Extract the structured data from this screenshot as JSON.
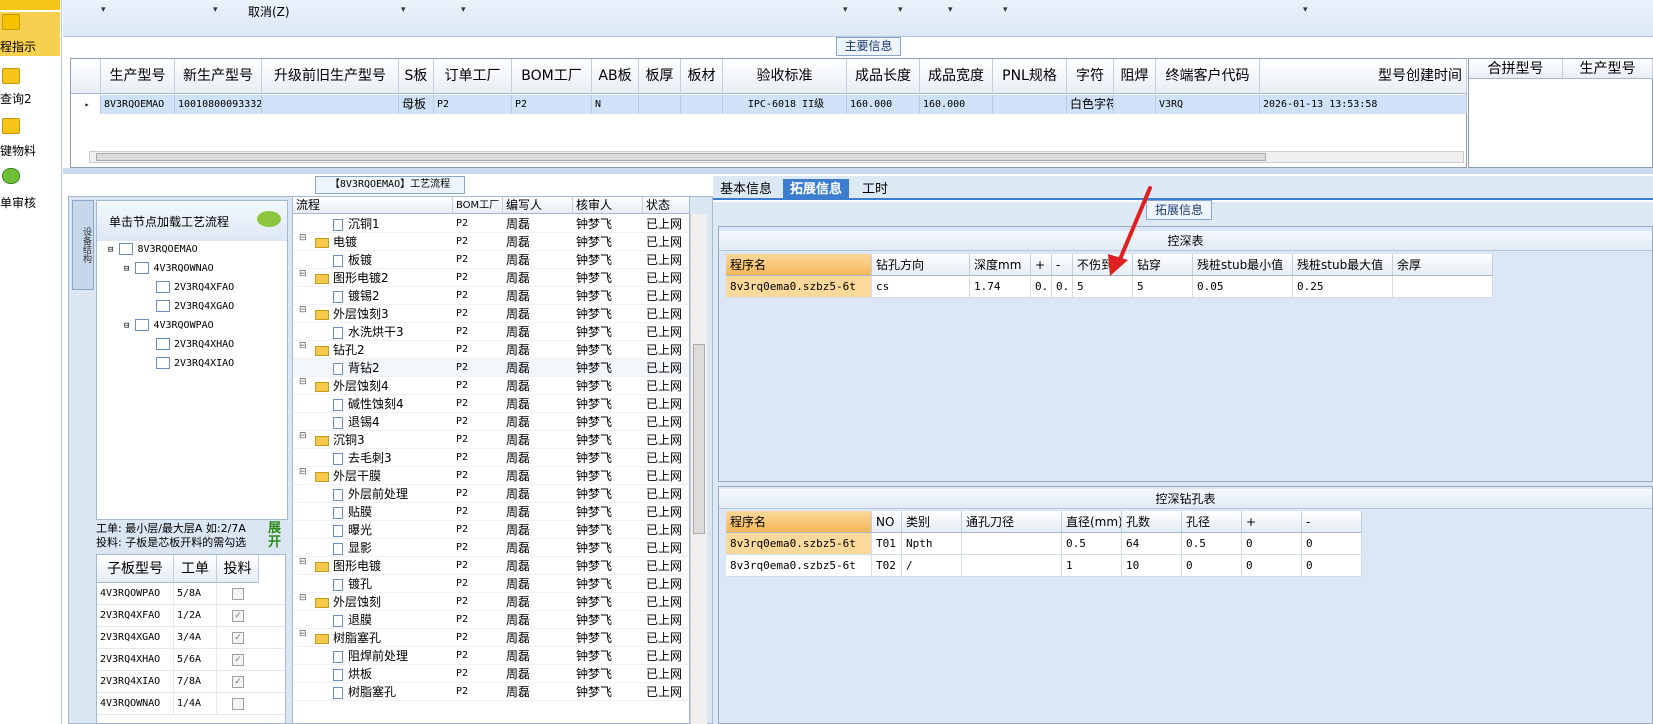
{
  "nav": {
    "items": [
      {
        "label": "程指示",
        "icon": "lightning-icon"
      },
      {
        "label": "查询2",
        "icon": "folder-icon"
      },
      {
        "label": "键物料",
        "icon": "folder-icon"
      },
      {
        "label": "单审核",
        "icon": "user-icon"
      }
    ]
  },
  "toolbar": {
    "cancel_label": "取消(Z)"
  },
  "main_info": {
    "title": "主要信息",
    "columns": [
      "生产型号",
      "新生产型号",
      "升级前旧生产型号",
      "S板",
      "订单工厂",
      "BOM工厂",
      "AB板",
      "板厚",
      "板材",
      "验收标准",
      "成品长度",
      "成品宽度",
      "PNL规格",
      "字符",
      "阻焊",
      "终端客户代码",
      "型号创建时间"
    ],
    "row": [
      "8V3RQOEMAO",
      "10010800093332",
      "",
      "母板",
      "P2",
      "P2",
      "N",
      "",
      "",
      "IPC-6018 II级",
      "160.000",
      "160.000",
      "",
      "白色字符",
      "",
      "V3RQ",
      "2026-01-13 13:53:58"
    ],
    "merge_columns": [
      "合拼型号",
      "生产型号"
    ]
  },
  "process": {
    "title": "【8V3RQOEMAO】工艺流程",
    "vtab_label": "设备结构",
    "tree_hint": "单击节点加载工艺流程",
    "tree": [
      {
        "label": "8V3RQOEMAO"
      },
      {
        "label": "4V3RQOWNAO"
      },
      {
        "label": "2V3RQ4XFAO"
      },
      {
        "label": "2V3RQ4XGAO"
      },
      {
        "label": "4V3RQOWPAO"
      },
      {
        "label": "2V3RQ4XHAO"
      },
      {
        "label": "2V3RQ4XIAO"
      }
    ],
    "info_line1": "工单: 最小层/最大层A 如:2/7A",
    "info_line2": "投料: 子板是芯板开料的需勾选",
    "expand_label": "展开",
    "sub_columns": [
      "子板型号",
      "工单",
      "投料"
    ],
    "sub_rows": [
      {
        "model": "4V3RQOWPAO",
        "order": "5/8A",
        "checked": false
      },
      {
        "model": "2V3RQ4XFAO",
        "order": "1/2A",
        "checked": true
      },
      {
        "model": "2V3RQ4XGAO",
        "order": "3/4A",
        "checked": true
      },
      {
        "model": "2V3RQ4XHAO",
        "order": "5/6A",
        "checked": true
      },
      {
        "model": "2V3RQ4XIAO",
        "order": "7/8A",
        "checked": true
      },
      {
        "model": "4V3RQOWNAO",
        "order": "1/4A",
        "checked": false
      }
    ],
    "flow_columns": [
      "流程",
      "BOM工厂",
      "编写人",
      "核审人",
      "状态"
    ],
    "flow_rows": [
      {
        "name": "沉铜1",
        "type": "doc",
        "bom": "P2",
        "author": "周磊",
        "reviewer": "钟梦飞",
        "status": "已上网"
      },
      {
        "name": "电镀",
        "type": "folder",
        "bom": "P2",
        "author": "周磊",
        "reviewer": "钟梦飞",
        "status": "已上网"
      },
      {
        "name": "板镀",
        "type": "doc",
        "bom": "P2",
        "author": "周磊",
        "reviewer": "钟梦飞",
        "status": "已上网"
      },
      {
        "name": "图形电镀2",
        "type": "folder",
        "bom": "P2",
        "author": "周磊",
        "reviewer": "钟梦飞",
        "status": "已上网"
      },
      {
        "name": "镀锡2",
        "type": "doc",
        "bom": "P2",
        "author": "周磊",
        "reviewer": "钟梦飞",
        "status": "已上网"
      },
      {
        "name": "外层蚀刻3",
        "type": "folder",
        "bom": "P2",
        "author": "周磊",
        "reviewer": "钟梦飞",
        "status": "已上网"
      },
      {
        "name": "水洗烘干3",
        "type": "doc",
        "bom": "P2",
        "author": "周磊",
        "reviewer": "钟梦飞",
        "status": "已上网"
      },
      {
        "name": "钻孔2",
        "type": "folder",
        "bom": "P2",
        "author": "周磊",
        "reviewer": "钟梦飞",
        "status": "已上网"
      },
      {
        "name": "背钻2",
        "type": "doc",
        "bom": "P2",
        "author": "周磊",
        "reviewer": "钟梦飞",
        "status": "已上网"
      },
      {
        "name": "外层蚀刻4",
        "type": "folder",
        "bom": "P2",
        "author": "周磊",
        "reviewer": "钟梦飞",
        "status": "已上网"
      },
      {
        "name": "碱性蚀刻4",
        "type": "doc",
        "bom": "P2",
        "author": "周磊",
        "reviewer": "钟梦飞",
        "status": "已上网"
      },
      {
        "name": "退锡4",
        "type": "doc",
        "bom": "P2",
        "author": "周磊",
        "reviewer": "钟梦飞",
        "status": "已上网"
      },
      {
        "name": "沉铜3",
        "type": "folder",
        "bom": "P2",
        "author": "周磊",
        "reviewer": "钟梦飞",
        "status": "已上网"
      },
      {
        "name": "去毛刺3",
        "type": "doc",
        "bom": "P2",
        "author": "周磊",
        "reviewer": "钟梦飞",
        "status": "已上网"
      },
      {
        "name": "外层干膜",
        "type": "folder",
        "bom": "P2",
        "author": "周磊",
        "reviewer": "钟梦飞",
        "status": "已上网"
      },
      {
        "name": "外层前处理",
        "type": "doc",
        "bom": "P2",
        "author": "周磊",
        "reviewer": "钟梦飞",
        "status": "已上网"
      },
      {
        "name": "贴膜",
        "type": "doc",
        "bom": "P2",
        "author": "周磊",
        "reviewer": "钟梦飞",
        "status": "已上网"
      },
      {
        "name": "曝光",
        "type": "doc",
        "bom": "P2",
        "author": "周磊",
        "reviewer": "钟梦飞",
        "status": "已上网"
      },
      {
        "name": "显影",
        "type": "doc",
        "bom": "P2",
        "author": "周磊",
        "reviewer": "钟梦飞",
        "status": "已上网"
      },
      {
        "name": "图形电镀",
        "type": "folder",
        "bom": "P2",
        "author": "周磊",
        "reviewer": "钟梦飞",
        "status": "已上网"
      },
      {
        "name": "镀孔",
        "type": "doc",
        "bom": "P2",
        "author": "周磊",
        "reviewer": "钟梦飞",
        "status": "已上网"
      },
      {
        "name": "外层蚀刻",
        "type": "folder",
        "bom": "P2",
        "author": "周磊",
        "reviewer": "钟梦飞",
        "status": "已上网"
      },
      {
        "name": "退膜",
        "type": "doc",
        "bom": "P2",
        "author": "周磊",
        "reviewer": "钟梦飞",
        "status": "已上网"
      },
      {
        "name": "树脂塞孔",
        "type": "folder",
        "bom": "P2",
        "author": "周磊",
        "reviewer": "钟梦飞",
        "status": "已上网"
      },
      {
        "name": "阻焊前处理",
        "type": "doc",
        "bom": "P2",
        "author": "周磊",
        "reviewer": "钟梦飞",
        "status": "已上网"
      },
      {
        "name": "烘板",
        "type": "doc",
        "bom": "P2",
        "author": "周磊",
        "reviewer": "钟梦飞",
        "status": "已上网"
      },
      {
        "name": "树脂塞孔",
        "type": "doc",
        "bom": "P2",
        "author": "周磊",
        "reviewer": "钟梦飞",
        "status": "已上网"
      }
    ]
  },
  "tabs": [
    "基本信息",
    "拓展信息",
    "工时"
  ],
  "ext": {
    "title": "拓展信息",
    "deep_title": "控深表",
    "deep_columns": [
      "程序名",
      "钻孔方向",
      "深度mm",
      "+",
      "-",
      "不伤到",
      "钻穿",
      "残桩stub最小值",
      "残桩stub最大值",
      "余厚"
    ],
    "deep_row": [
      "8v3rq0ema0.szbz5-6t",
      "cs",
      "1.74",
      "0.",
      "0.",
      "5",
      "5",
      "0.05",
      "0.25",
      ""
    ],
    "hole_title": "控深钻孔表",
    "hole_columns": [
      "程序名",
      "NO",
      "类别",
      "通孔刀径",
      "直径(mm)",
      "孔数",
      "孔径",
      "+",
      "-"
    ],
    "hole_rows": [
      [
        "8v3rq0ema0.szbz5-6t",
        "T01",
        "Npth",
        "",
        "0.5",
        "64",
        "0.5",
        "0",
        "0"
      ],
      [
        "8v3rq0ema0.szbz5-6t",
        "T02",
        "/",
        "",
        "1",
        "10",
        "0",
        "0",
        "0"
      ]
    ]
  },
  "colors": {
    "accent": "#3c7dd0",
    "selected_row": "#cfe2f7",
    "header_highlight": "#f4b75a",
    "arrow": "#e02020"
  }
}
